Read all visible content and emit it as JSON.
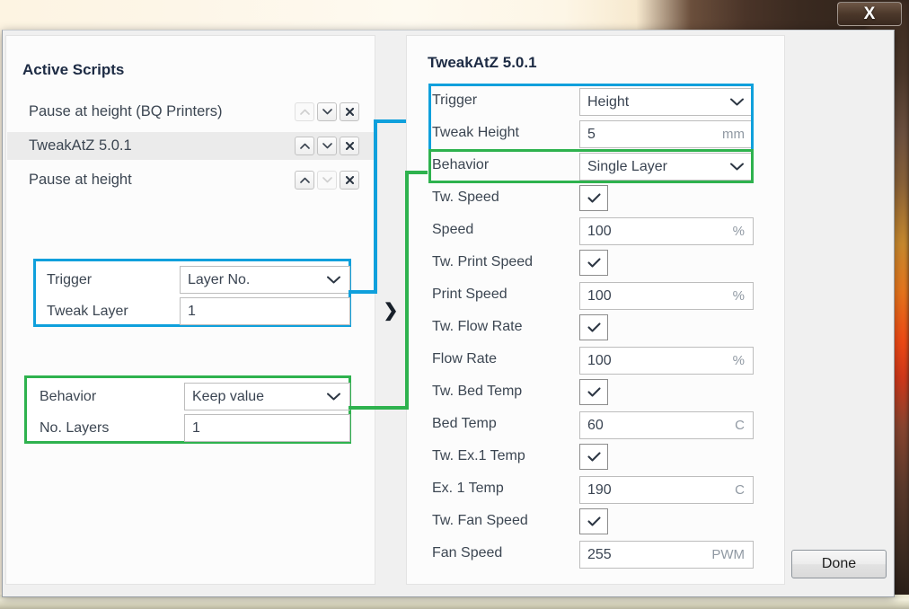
{
  "window": {
    "close_label": "X"
  },
  "left_panel": {
    "title": "Active Scripts",
    "scripts": [
      {
        "name": "Pause at height (BQ Printers)",
        "up_enabled": false,
        "down_enabled": true,
        "selected": false
      },
      {
        "name": "TweakAtZ 5.0.1",
        "up_enabled": true,
        "down_enabled": true,
        "selected": true
      },
      {
        "name": "Pause at height",
        "up_enabled": true,
        "down_enabled": false,
        "selected": false
      }
    ],
    "trigger_group": {
      "trigger_label": "Trigger",
      "trigger_value": "Layer No.",
      "tweak_label": "Tweak Layer",
      "tweak_value": "1"
    },
    "behavior_group": {
      "behavior_label": "Behavior",
      "behavior_value": "Keep value",
      "layers_label": "No. Layers",
      "layers_value": "1"
    }
  },
  "splitter": {
    "handle": "❯"
  },
  "right_panel": {
    "title": "TweakAtZ 5.0.1",
    "rows": [
      {
        "label": "Trigger",
        "kind": "select",
        "value": "Height",
        "unit": ""
      },
      {
        "label": "Tweak Height",
        "kind": "text",
        "value": "5",
        "unit": "mm"
      },
      {
        "label": "Behavior",
        "kind": "select",
        "value": "Single Layer",
        "unit": ""
      },
      {
        "label": "Tw. Speed",
        "kind": "checkbox",
        "value": "checked",
        "unit": ""
      },
      {
        "label": "Speed",
        "kind": "text",
        "value": "100",
        "unit": "%"
      },
      {
        "label": "Tw. Print Speed",
        "kind": "checkbox",
        "value": "checked",
        "unit": ""
      },
      {
        "label": "Print Speed",
        "kind": "text",
        "value": "100",
        "unit": "%"
      },
      {
        "label": "Tw. Flow Rate",
        "kind": "checkbox",
        "value": "checked",
        "unit": ""
      },
      {
        "label": "Flow Rate",
        "kind": "text",
        "value": "100",
        "unit": "%"
      },
      {
        "label": "Tw. Bed Temp",
        "kind": "checkbox",
        "value": "checked",
        "unit": ""
      },
      {
        "label": "Bed Temp",
        "kind": "text",
        "value": "60",
        "unit": "C"
      },
      {
        "label": "Tw. Ex.1 Temp",
        "kind": "checkbox",
        "value": "checked",
        "unit": ""
      },
      {
        "label": "Ex. 1 Temp",
        "kind": "text",
        "value": "190",
        "unit": "C"
      },
      {
        "label": "Tw. Fan Speed",
        "kind": "checkbox",
        "value": "checked",
        "unit": ""
      },
      {
        "label": "Fan Speed",
        "kind": "text",
        "value": "255",
        "unit": "PWM"
      }
    ]
  },
  "footer": {
    "done_label": "Done"
  },
  "colors": {
    "highlight_blue": "#0fa0dc",
    "highlight_green": "#2eb24e"
  }
}
